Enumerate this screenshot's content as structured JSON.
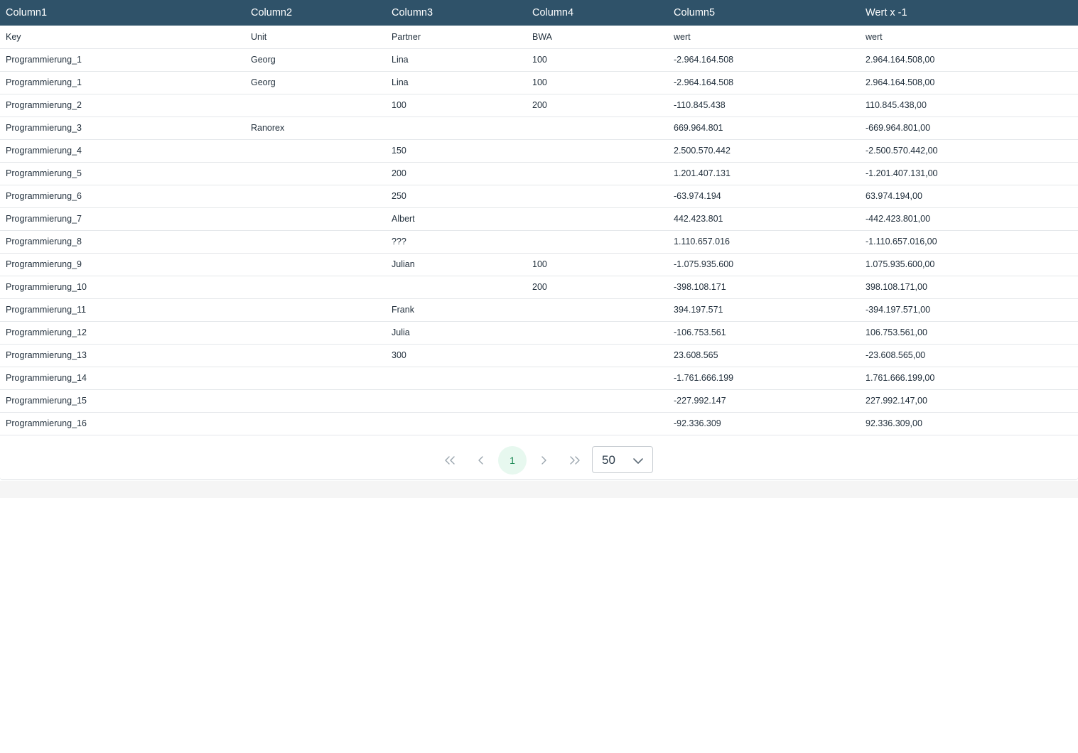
{
  "table": {
    "columns": [
      "Column1",
      "Column2",
      "Column3",
      "Column4",
      "Column5",
      "Wert x -1"
    ],
    "rows": [
      [
        "Key",
        "Unit",
        "Partner",
        "BWA",
        "wert",
        "wert"
      ],
      [
        "Programmierung_1",
        "Georg",
        "Lina",
        "100",
        "-2.964.164.508",
        "2.964.164.508,00"
      ],
      [
        "Programmierung_1",
        "Georg",
        "Lina",
        "100",
        "-2.964.164.508",
        "2.964.164.508,00"
      ],
      [
        "Programmierung_2",
        "",
        "100",
        "200",
        "-110.845.438",
        "110.845.438,00"
      ],
      [
        "Programmierung_3",
        "Ranorex",
        "",
        "",
        "669.964.801",
        "-669.964.801,00"
      ],
      [
        "Programmierung_4",
        "",
        "150",
        "",
        "2.500.570.442",
        "-2.500.570.442,00"
      ],
      [
        "Programmierung_5",
        "",
        "200",
        "",
        "1.201.407.131",
        "-1.201.407.131,00"
      ],
      [
        "Programmierung_6",
        "",
        "250",
        "",
        "-63.974.194",
        "63.974.194,00"
      ],
      [
        "Programmierung_7",
        "",
        "Albert",
        "",
        "442.423.801",
        "-442.423.801,00"
      ],
      [
        "Programmierung_8",
        "",
        "???",
        "",
        "1.110.657.016",
        "-1.110.657.016,00"
      ],
      [
        "Programmierung_9",
        "",
        "Julian",
        "100",
        "-1.075.935.600",
        "1.075.935.600,00"
      ],
      [
        "Programmierung_10",
        "",
        "",
        "200",
        "-398.108.171",
        "398.108.171,00"
      ],
      [
        "Programmierung_11",
        "",
        "Frank",
        "",
        "394.197.571",
        "-394.197.571,00"
      ],
      [
        "Programmierung_12",
        "",
        "Julia",
        "",
        "-106.753.561",
        "106.753.561,00"
      ],
      [
        "Programmierung_13",
        "",
        "300",
        "",
        "23.608.565",
        "-23.608.565,00"
      ],
      [
        "Programmierung_14",
        "",
        "",
        "",
        "-1.761.666.199",
        "1.761.666.199,00"
      ],
      [
        "Programmierung_15",
        "",
        "",
        "",
        "-227.992.147",
        "227.992.147,00"
      ],
      [
        "Programmierung_16",
        "",
        "",
        "",
        "-92.336.309",
        "92.336.309,00"
      ]
    ]
  },
  "pagination": {
    "current_page": "1",
    "page_size": "50",
    "icons": {
      "first": "double-chevron-left-icon",
      "prev": "chevron-left-icon",
      "next": "chevron-right-icon",
      "last": "double-chevron-right-icon",
      "dropdown": "chevron-down-icon"
    }
  },
  "colors": {
    "header_background": "#2f5269",
    "current_page_background": "#e7f8ef",
    "current_page_text": "#1e8a56"
  }
}
